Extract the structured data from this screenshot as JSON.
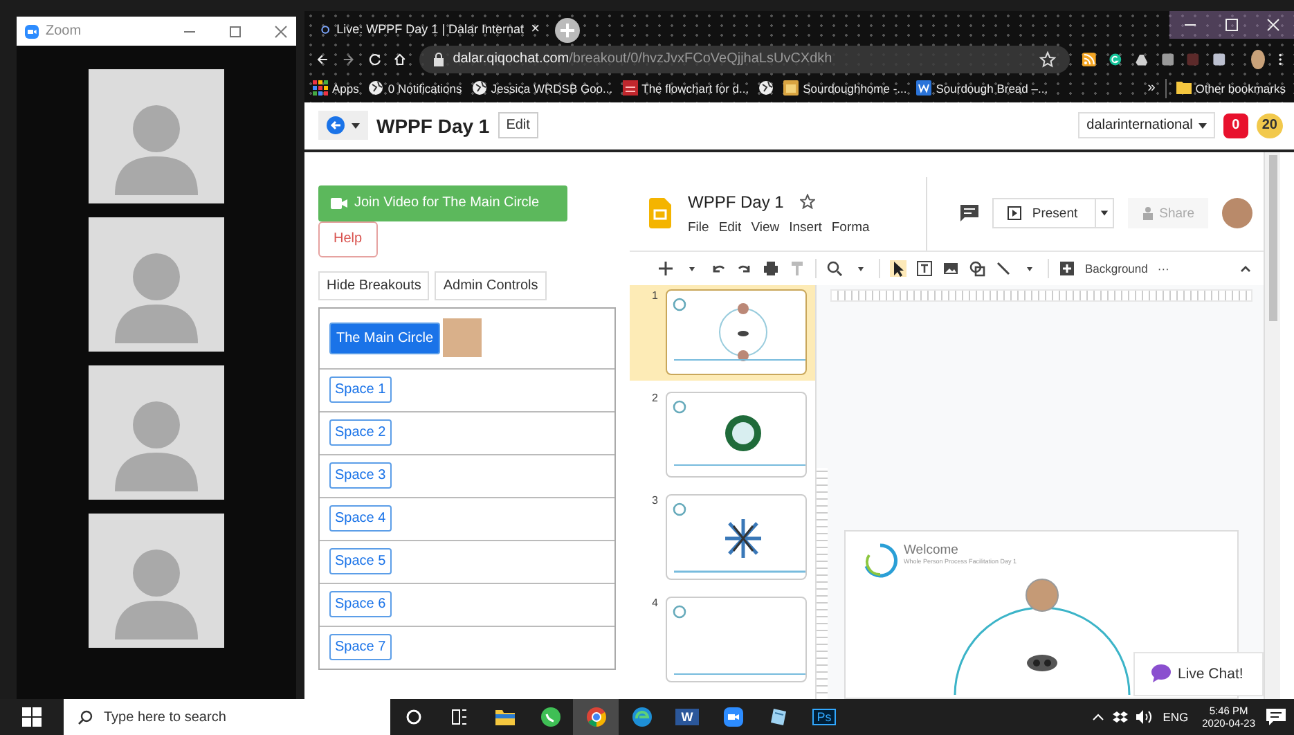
{
  "zoom_window": {
    "title": "Zoom",
    "tiles": [
      {
        "kind": "avatar"
      },
      {
        "kind": "avatar"
      },
      {
        "kind": "avatar"
      },
      {
        "kind": "avatar"
      }
    ]
  },
  "browser": {
    "tab": {
      "title": "Live: WPPF Day 1 | Dalar Internat",
      "close": "×"
    },
    "address": {
      "host": "dalar.qiqochat.com",
      "path": "/breakout/0/hvzJvxFCoVeQjjhaLsUvCXdkh"
    },
    "bookmarks": [
      {
        "kind": "apps",
        "label": "Apps"
      },
      {
        "kind": "globe",
        "label": "0 Notifications"
      },
      {
        "kind": "globe",
        "label": "Jessica WRDSB Goo..."
      },
      {
        "kind": "red",
        "label": "The flowchart for d..."
      },
      {
        "kind": "globe"
      },
      {
        "kind": "bread",
        "label": "Sourdoughhome -..."
      },
      {
        "kind": "word",
        "label": "Sourdough Bread –..."
      }
    ],
    "overflow": "»",
    "other": "Other bookmarks"
  },
  "page": {
    "title": "WPPF Day 1",
    "edit": "Edit",
    "account": "dalarinternational",
    "badges": [
      {
        "text": "0",
        "color": "#e8112d"
      },
      {
        "text": "20",
        "color": "#f2c94c"
      }
    ],
    "join": "Join Video for The Main Circle",
    "help": "Help",
    "tools": [
      "Hide Breakouts",
      "Admin Controls"
    ],
    "rooms": [
      {
        "name": "The Main Circle",
        "selected": true,
        "photo": true
      },
      {
        "name": "Space 1",
        "selected": false
      },
      {
        "name": "Space 2",
        "selected": false
      },
      {
        "name": "Space 3",
        "selected": false
      },
      {
        "name": "Space 4",
        "selected": false
      },
      {
        "name": "Space 5",
        "selected": false
      },
      {
        "name": "Space 6",
        "selected": false
      },
      {
        "name": "Space 7",
        "selected": false
      }
    ]
  },
  "slides": {
    "title": "WPPF Day 1",
    "menus": [
      "File",
      "Edit",
      "View",
      "Insert",
      "Forma"
    ],
    "present": "Present",
    "share": "Share",
    "background": "Background",
    "more": "···",
    "thumbnails": [
      {
        "number": "1",
        "kind": "circle",
        "selected": true
      },
      {
        "number": "2",
        "kind": "wreath",
        "selected": false
      },
      {
        "number": "3",
        "kind": "burst",
        "selected": false
      },
      {
        "number": "4",
        "kind": "blank",
        "selected": false
      }
    ],
    "canvas": {
      "heading": "Welcome",
      "subtitle": "Whole Person Process Facilitation Day 1"
    },
    "live_chat": "Live Chat!"
  },
  "taskbar": {
    "search": "Type here to search",
    "apps": [
      {
        "kind": "cortana",
        "selected": false
      },
      {
        "kind": "taskview",
        "selected": false
      },
      {
        "kind": "explorer",
        "selected": false
      },
      {
        "kind": "whatsapp",
        "selected": false
      },
      {
        "kind": "chrome",
        "selected": true
      },
      {
        "kind": "edge",
        "selected": false
      },
      {
        "kind": "word",
        "selected": false,
        "label": "W"
      },
      {
        "kind": "zoom",
        "selected": false
      },
      {
        "kind": "notes",
        "selected": false
      },
      {
        "kind": "photoshop",
        "selected": false,
        "label": "Ps"
      }
    ],
    "language": "ENG",
    "time": "5:46 PM",
    "date": "2020-04-23"
  }
}
